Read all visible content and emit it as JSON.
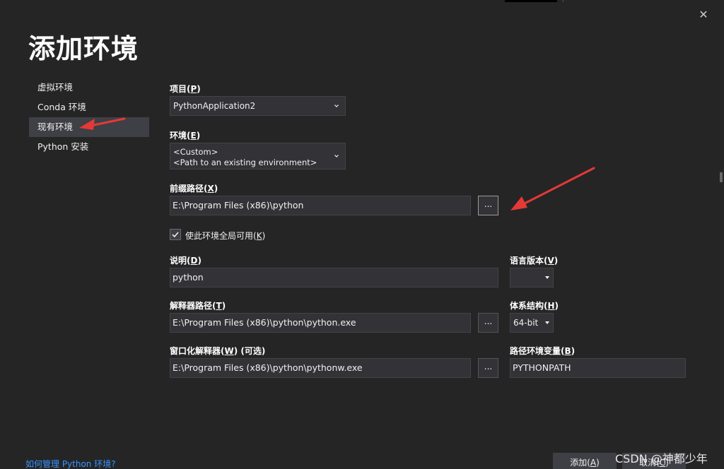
{
  "dialog": {
    "title": "添加环境",
    "close_glyph": "✕"
  },
  "sidebar": {
    "items": [
      {
        "label": "虚拟环境"
      },
      {
        "label": "Conda 环境"
      },
      {
        "label": "现有环境"
      },
      {
        "label": "Python 安装"
      }
    ],
    "selected": "现有环境"
  },
  "form": {
    "project": {
      "label": "项目(",
      "key": "P",
      "label_end": ")",
      "value": "PythonApplication2"
    },
    "environment": {
      "label": "环境(",
      "key": "E",
      "label_end": ")",
      "value_line1": "<Custom>",
      "value_line2": "<Path to an existing environment>"
    },
    "prefix_path": {
      "label": "前缀路径(",
      "key": "X",
      "label_end": ")",
      "value": "E:\\Program Files (x86)\\python",
      "browse": "..."
    },
    "global": {
      "label": "使此环境全局可用(",
      "key": "K",
      "label_end": ")",
      "checked": true
    },
    "description": {
      "label": "说明(",
      "key": "D",
      "label_end": ")",
      "value": "python"
    },
    "language_version": {
      "label": "语言版本(",
      "key": "V",
      "label_end": ")",
      "value": ""
    },
    "interpreter_path": {
      "label": "解释器路径(",
      "key": "T",
      "label_end": ")",
      "value": "E:\\Program Files (x86)\\python\\python.exe",
      "browse": "..."
    },
    "architecture": {
      "label": "体系结构(",
      "key": "H",
      "label_end": ")",
      "value": "64-bit"
    },
    "windowed_interpreter": {
      "label": "窗口化解释器(",
      "key": "W",
      "label_end": ") (可选)",
      "value": "E:\\Program Files (x86)\\python\\pythonw.exe",
      "browse": "..."
    },
    "path_env_var": {
      "label": "路径环境变量(",
      "key": "B",
      "label_end": ")",
      "value": "PYTHONPATH"
    }
  },
  "footer": {
    "help_link": "如何管理 Python 环境?",
    "add_button": {
      "label": "添加(",
      "key": "A",
      "label_end": ")"
    },
    "cancel_button": {
      "label": "取消(",
      "key": "C",
      "label_end": ")"
    },
    "watermark": "CSDN @神都少年"
  },
  "colors": {
    "background": "#252526",
    "input_bg": "#333337",
    "selected_nav": "#3f3f46",
    "link": "#3794ff",
    "annotation_arrow": "#e53935"
  },
  "icons": {
    "close": "close-icon",
    "chevron": "chevron-down-icon",
    "check": "checkmark-icon"
  }
}
